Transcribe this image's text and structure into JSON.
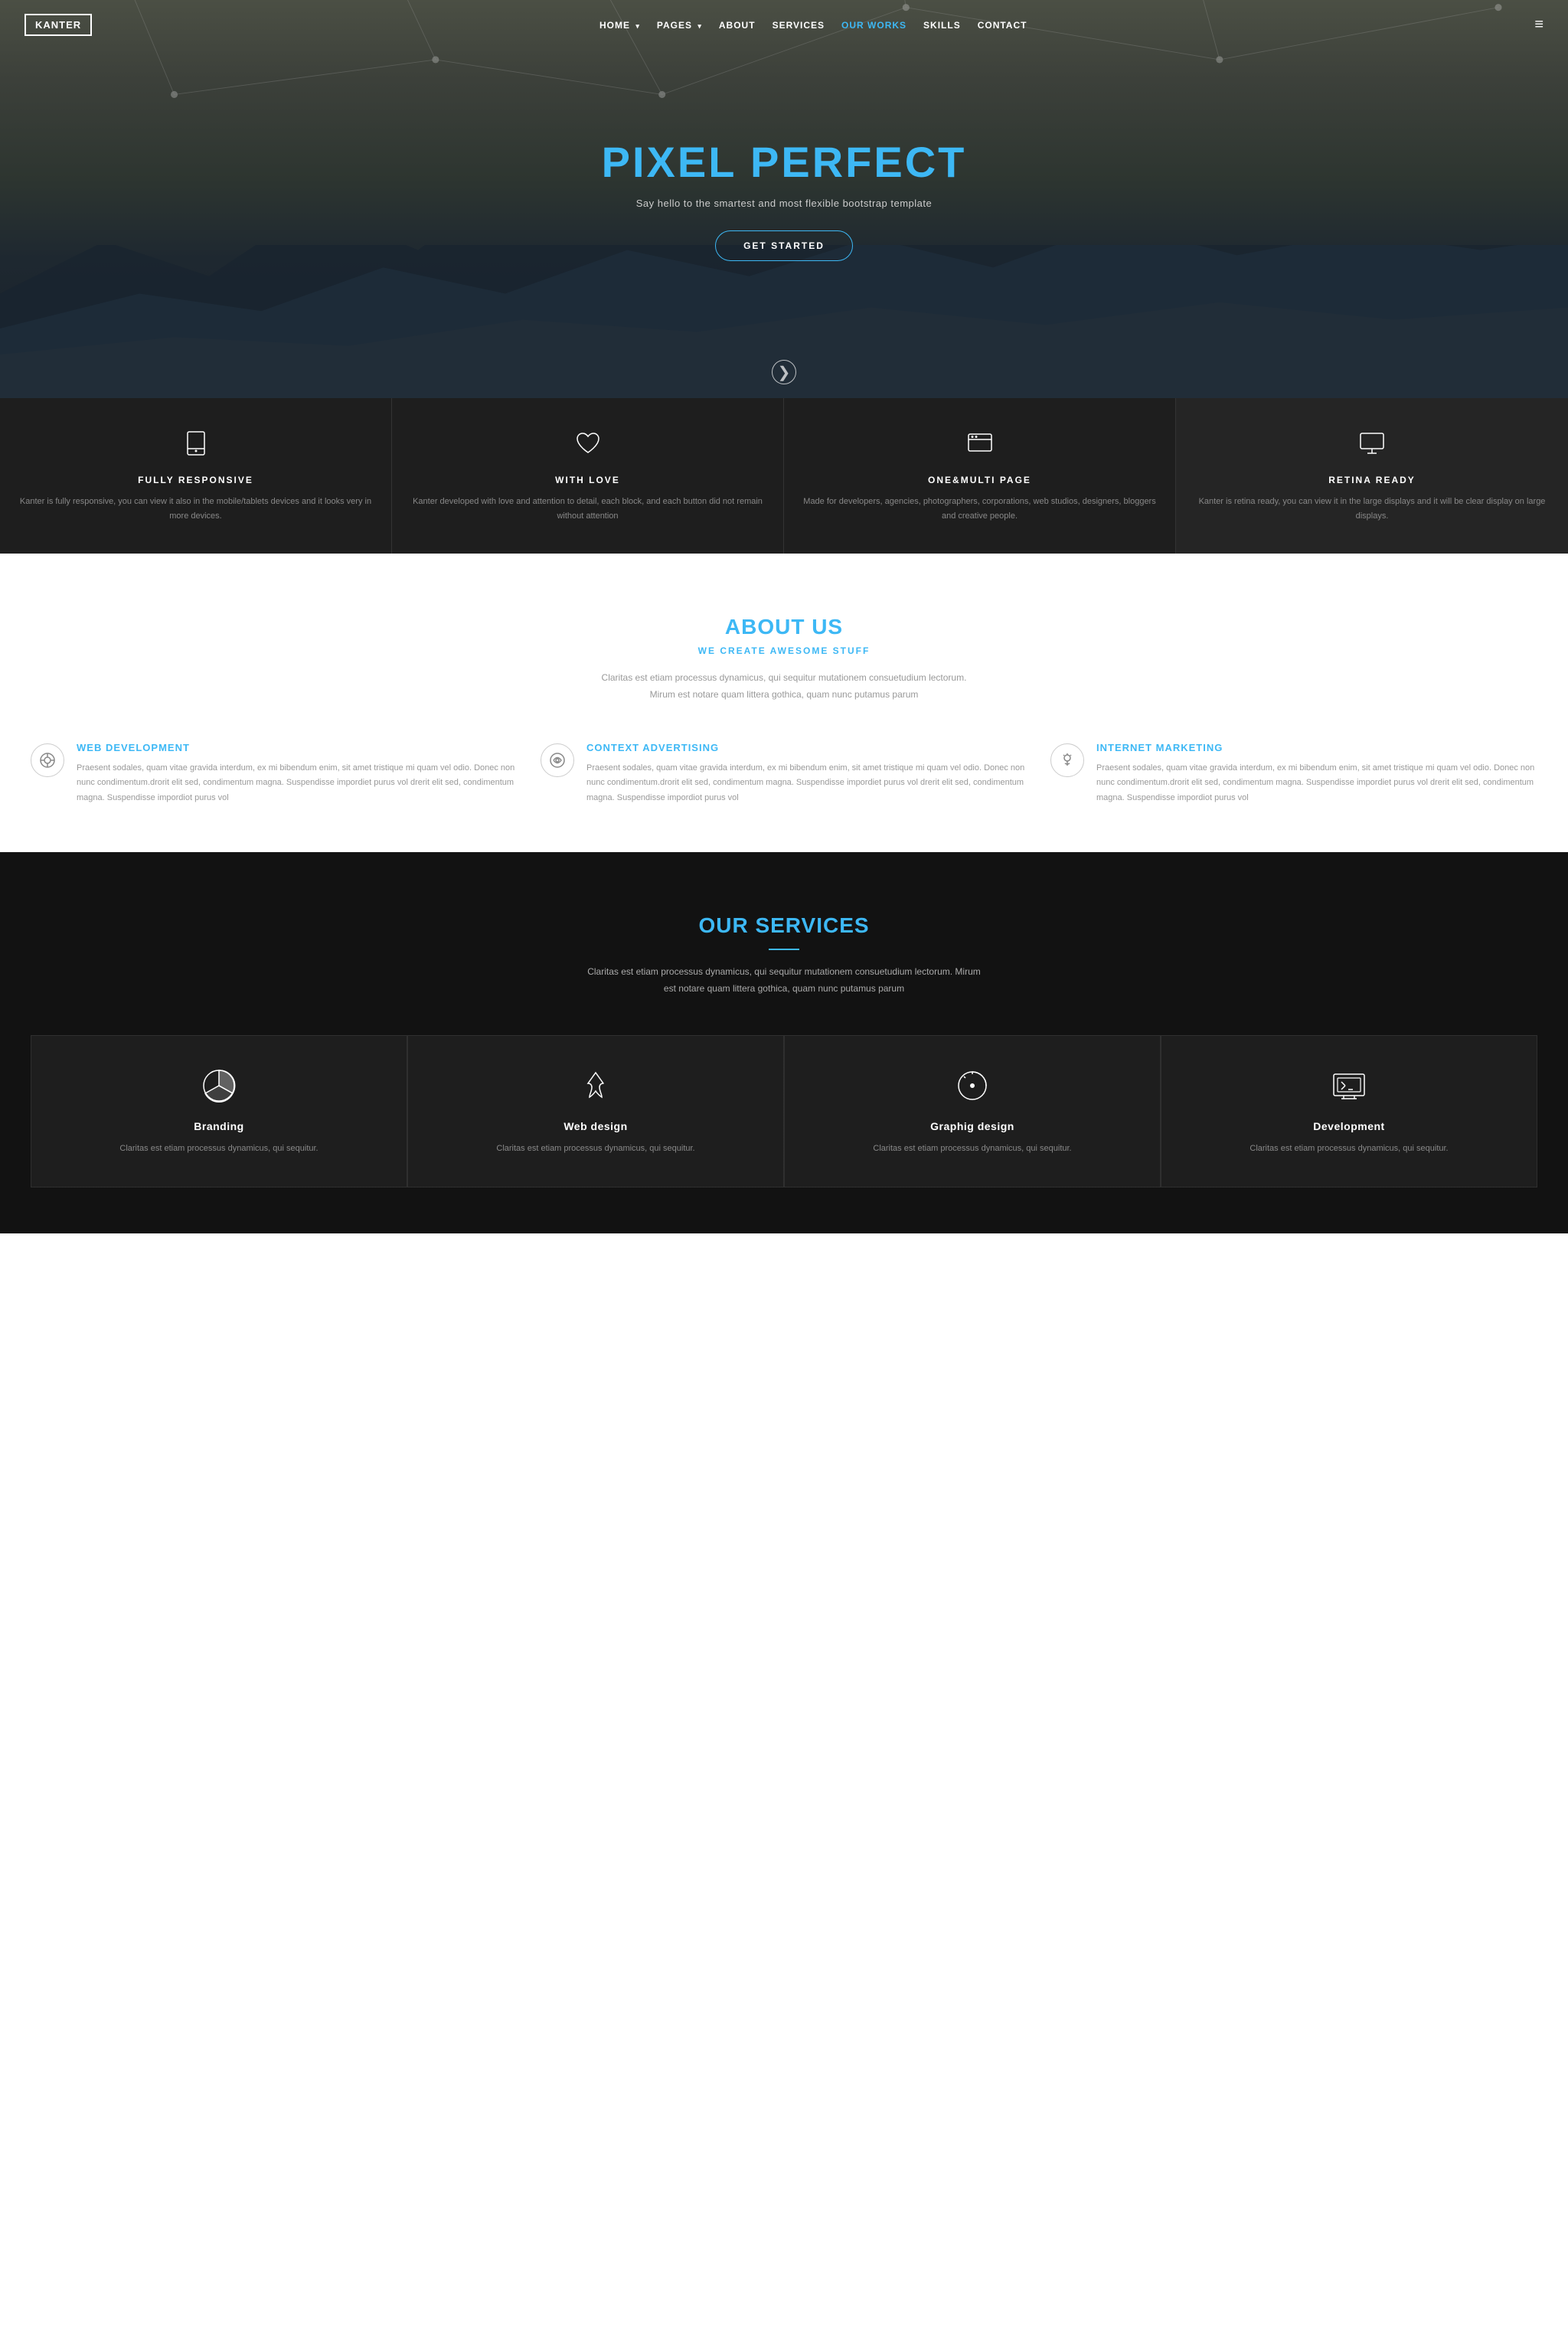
{
  "nav": {
    "logo": "KANTER",
    "links": [
      {
        "label": "HOME",
        "has_arrow": true,
        "active": false
      },
      {
        "label": "PAGES",
        "has_arrow": true,
        "active": false
      },
      {
        "label": "ABOUT",
        "has_arrow": false,
        "active": false
      },
      {
        "label": "SERVICES",
        "has_arrow": false,
        "active": false
      },
      {
        "label": "OUR WORKS",
        "has_arrow": false,
        "active": true
      },
      {
        "label": "SKILLS",
        "has_arrow": false,
        "active": false
      },
      {
        "label": "CONTACT",
        "has_arrow": false,
        "active": false
      }
    ]
  },
  "hero": {
    "title_part1": "PIXEL ",
    "title_part2": "PERFECT",
    "subtitle": "Say hello to the smartest and most flexible bootstrap template",
    "cta": "GET STARTED",
    "scroll_icon": "❯"
  },
  "features": [
    {
      "icon": "tablet",
      "title": "FULLY RESPONSIVE",
      "text": "Kanter is fully responsive, you can view it also in the mobile/tablets devices and it looks very in more devices."
    },
    {
      "icon": "heart",
      "title": "WITH LOVE",
      "text": "Kanter developed with love and attention to detail, each block, and each button did not remain without attention"
    },
    {
      "icon": "browser",
      "title": "ONE&MULTI PAGE",
      "text": "Made for developers, agencies, photographers, corporations, web studios, designers, bloggers and creative people."
    },
    {
      "icon": "monitor",
      "title": "RETINA READY",
      "text": "Kanter is retina ready, you can view it in the large displays and it will be clear display on large displays."
    }
  ],
  "about": {
    "title_part1": "ABOUT ",
    "title_part2": "US",
    "subtitle_part1": "WE CREATE",
    "subtitle_part2": " AWESOME STUFF",
    "description": "Claritas est etiam processus dynamicus, qui sequitur mutationem consuetudium lectorum. Mirum est notare quam littera gothica, quam nunc putamus parum",
    "features": [
      {
        "icon": "◎",
        "title_part1": "WEB ",
        "title_part2": "DEVELOPMENT",
        "text": "Praesent sodales, quam vitae gravida interdum, ex mi bibendum enim, sit amet tristique mi quam vel odio. Donec non nunc condimentum.drorit elit sed, condimentum magna. Suspendisse impordiet purus vol drerit elit sed, condimentum magna. Suspendisse impordiot purus vol"
      },
      {
        "icon": "◎",
        "title_part1": "CONTEXT ",
        "title_part2": "ADVERTISING",
        "text": "Praesent sodales, quam vitae gravida interdum, ex mi bibendum enim, sit amet tristique mi quam vel odio. Donec non nunc condimentum.drorit elit sed, condimentum magna. Suspendisse impordiet purus vol drerit elit sed, condimentum magna. Suspendisse impordiot purus vol"
      },
      {
        "icon": "💡",
        "title_part1": "INTERNET ",
        "title_part2": "MARKETING",
        "text": "Praesent sodales, quam vitae gravida interdum, ex mi bibendum enim, sit amet tristique mi quam vel odio. Donec non nunc condimentum.drorit elit sed, condimentum magna. Suspendisse impordiet purus vol drerit elit sed, condimentum magna. Suspendisse impordiot purus vol"
      }
    ]
  },
  "services": {
    "title_part1": "OUR ",
    "title_part2": "SERVICES",
    "description": "Claritas est etiam processus dynamicus, qui sequitur mutationem consuetudium lectorum. Mirum est notare quam littera gothica, quam nunc putamus parum",
    "cards": [
      {
        "icon": "pie",
        "title": "Branding",
        "text": "Claritas est etiam processus dynamicus, qui sequitur."
      },
      {
        "icon": "drop",
        "title": "Web design",
        "text": "Claritas est etiam processus dynamicus, qui sequitur."
      },
      {
        "icon": "dial",
        "title": "Graphig design",
        "text": "Claritas est etiam processus dynamicus, qui sequitur."
      },
      {
        "icon": "map",
        "title": "Development",
        "text": "Claritas est etiam processus dynamicus, qui sequitur."
      }
    ]
  }
}
